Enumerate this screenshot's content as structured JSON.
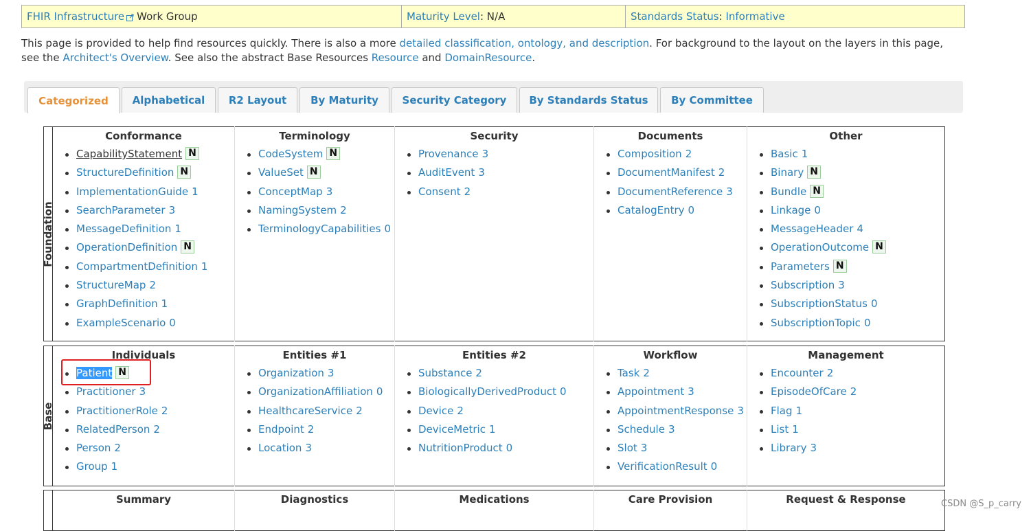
{
  "header": {
    "work_group_link": "FHIR Infrastructure",
    "work_group_suffix": "Work Group",
    "maturity_label": "Maturity Level",
    "maturity_value": ": N/A",
    "status_label": "Standards Status",
    "status_sep": ": ",
    "status_value": "Informative"
  },
  "intro": {
    "t1": "This page is provided to help find resources quickly. There is also a more ",
    "l1": "detailed classification, ontology, and description",
    "t2": ". For background to the layout on the layers in this page, see the ",
    "l2": "Architect's Overview",
    "t3": ". See also the abstract Base Resources ",
    "l3": "Resource",
    "t4": " and ",
    "l4": "DomainResource",
    "t5": "."
  },
  "tabs": [
    "Categorized",
    "Alphabetical",
    "R2 Layout",
    "By Maturity",
    "Security Category",
    "By Standards Status",
    "By Committee"
  ],
  "active_tab": "Categorized",
  "foundation": {
    "label": "Foundation",
    "columns": [
      {
        "title": "Conformance",
        "items": [
          {
            "name": "CapabilityStatement",
            "level": "N"
          },
          {
            "name": "StructureDefinition",
            "level": "N"
          },
          {
            "name": "ImplementationGuide",
            "level": "1"
          },
          {
            "name": "SearchParameter",
            "level": "3"
          },
          {
            "name": "MessageDefinition",
            "level": "1"
          },
          {
            "name": "OperationDefinition",
            "level": "N"
          },
          {
            "name": "CompartmentDefinition",
            "level": "1"
          },
          {
            "name": "StructureMap",
            "level": "2"
          },
          {
            "name": "GraphDefinition",
            "level": "1"
          },
          {
            "name": "ExampleScenario",
            "level": "0"
          }
        ]
      },
      {
        "title": "Terminology",
        "items": [
          {
            "name": "CodeSystem",
            "level": "N"
          },
          {
            "name": "ValueSet",
            "level": "N"
          },
          {
            "name": "ConceptMap",
            "level": "3"
          },
          {
            "name": "NamingSystem",
            "level": "2"
          },
          {
            "name": "TerminologyCapabilities",
            "level": "0"
          }
        ]
      },
      {
        "title": "Security",
        "items": [
          {
            "name": "Provenance",
            "level": "3"
          },
          {
            "name": "AuditEvent",
            "level": "3"
          },
          {
            "name": "Consent",
            "level": "2"
          }
        ]
      },
      {
        "title": "Documents",
        "items": [
          {
            "name": "Composition",
            "level": "2"
          },
          {
            "name": "DocumentManifest",
            "level": "2"
          },
          {
            "name": "DocumentReference",
            "level": "3"
          },
          {
            "name": "CatalogEntry",
            "level": "0"
          }
        ]
      },
      {
        "title": "Other",
        "items": [
          {
            "name": "Basic",
            "level": "1"
          },
          {
            "name": "Binary",
            "level": "N"
          },
          {
            "name": "Bundle",
            "level": "N"
          },
          {
            "name": "Linkage",
            "level": "0"
          },
          {
            "name": "MessageHeader",
            "level": "4"
          },
          {
            "name": "OperationOutcome",
            "level": "N"
          },
          {
            "name": "Parameters",
            "level": "N"
          },
          {
            "name": "Subscription",
            "level": "3"
          },
          {
            "name": "SubscriptionStatus",
            "level": "0"
          },
          {
            "name": "SubscriptionTopic",
            "level": "0"
          }
        ]
      }
    ]
  },
  "base": {
    "label": "Base",
    "columns": [
      {
        "title": "Individuals",
        "items": [
          {
            "name": "Patient",
            "level": "N"
          },
          {
            "name": "Practitioner",
            "level": "3"
          },
          {
            "name": "PractitionerRole",
            "level": "2"
          },
          {
            "name": "RelatedPerson",
            "level": "2"
          },
          {
            "name": "Person",
            "level": "2"
          },
          {
            "name": "Group",
            "level": "1"
          }
        ]
      },
      {
        "title": "Entities #1",
        "items": [
          {
            "name": "Organization",
            "level": "3"
          },
          {
            "name": "OrganizationAffiliation",
            "level": "0"
          },
          {
            "name": "HealthcareService",
            "level": "2"
          },
          {
            "name": "Endpoint",
            "level": "2"
          },
          {
            "name": "Location",
            "level": "3"
          }
        ]
      },
      {
        "title": "Entities #2",
        "items": [
          {
            "name": "Substance",
            "level": "2"
          },
          {
            "name": "BiologicallyDerivedProduct",
            "level": "0"
          },
          {
            "name": "Device",
            "level": "2"
          },
          {
            "name": "DeviceMetric",
            "level": "1"
          },
          {
            "name": "NutritionProduct",
            "level": "0"
          }
        ]
      },
      {
        "title": "Workflow",
        "items": [
          {
            "name": "Task",
            "level": "2"
          },
          {
            "name": "Appointment",
            "level": "3"
          },
          {
            "name": "AppointmentResponse",
            "level": "3"
          },
          {
            "name": "Schedule",
            "level": "3"
          },
          {
            "name": "Slot",
            "level": "3"
          },
          {
            "name": "VerificationResult",
            "level": "0"
          }
        ]
      },
      {
        "title": "Management",
        "items": [
          {
            "name": "Encounter",
            "level": "2"
          },
          {
            "name": "EpisodeOfCare",
            "level": "2"
          },
          {
            "name": "Flag",
            "level": "1"
          },
          {
            "name": "List",
            "level": "1"
          },
          {
            "name": "Library",
            "level": "3"
          }
        ]
      }
    ]
  },
  "clinical_titles": [
    "Summary",
    "Diagnostics",
    "Medications",
    "Care Provision",
    "Request & Response"
  ],
  "watermark": "CSDN @S_p_carry"
}
